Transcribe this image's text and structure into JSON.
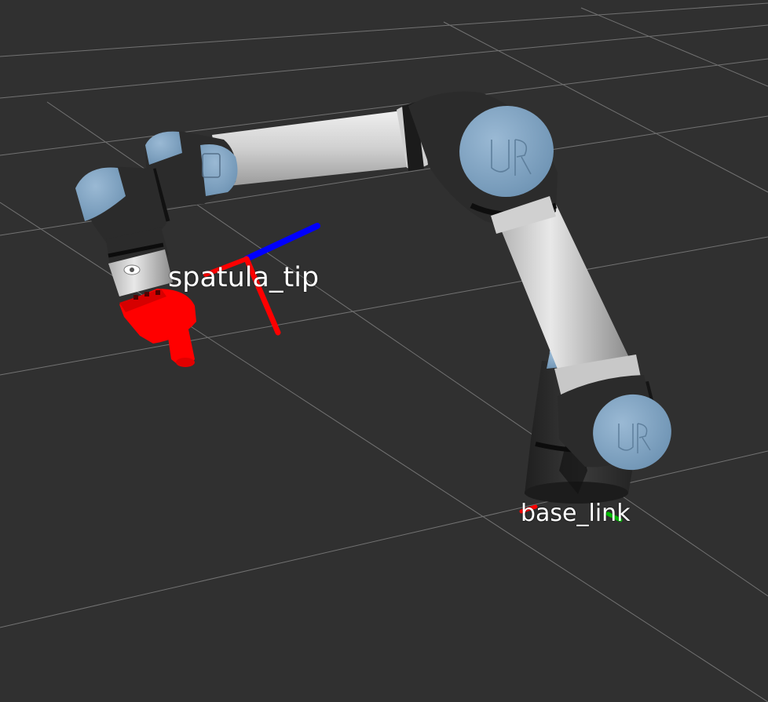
{
  "viewport": {
    "frames": {
      "spatula_tip": "spatula_tip",
      "base_link": "base_link"
    },
    "robot": {
      "model_logo": "UR"
    },
    "colors": {
      "background": "#303030",
      "grid_line": "#a0a0a0",
      "robot_dark": "#2a2a2a",
      "robot_light": "#d8d8d8",
      "robot_cap": "#7fa3c2",
      "tool": "#ff0000",
      "axis_x": "#ff0000",
      "axis_y": "#00c000",
      "axis_z": "#0000ff"
    }
  }
}
